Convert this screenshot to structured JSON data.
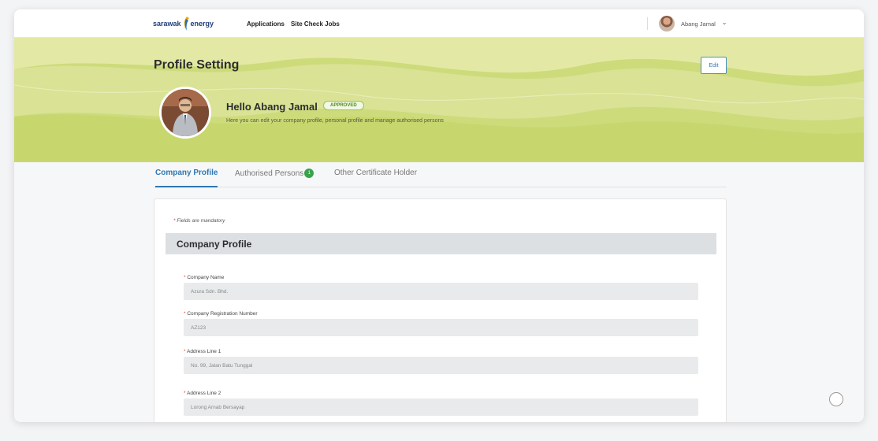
{
  "header": {
    "logo_left": "sarawak",
    "logo_right": "energy",
    "nav": [
      "Applications",
      "Site Check Jobs"
    ],
    "user_name": "Abang Jamal",
    "user_chevron": "⌄"
  },
  "banner": {
    "title": "Profile Setting",
    "edit_label": "Edit",
    "greeting": "Hello Abang Jamal",
    "status": "APPROVED",
    "subtitle": "Here you can edit your company profile, personal profile and manage authorised persons"
  },
  "tabs": [
    {
      "label": "Company Profile",
      "active": true
    },
    {
      "label": "Authorised Persons",
      "count": "1"
    },
    {
      "label": "Other Certificate Holder"
    }
  ],
  "form": {
    "mandatory_note": "Fields are mandatory",
    "section_title": "Company Profile",
    "fields": [
      {
        "label": "Company Name",
        "value": "Azura Sdn. Bhd."
      },
      {
        "label": "Company Registration Number",
        "value": "AZ123"
      },
      {
        "label": "Address Line 1",
        "value": "No. 99, Jalan Batu Tunggal"
      },
      {
        "label": "Address Line 2",
        "value": "Lorong Arnab Bersayap"
      }
    ]
  },
  "icons": {
    "logo": "sarawak-energy-flame-icon",
    "user_menu": "chevron-down-icon",
    "fab": "circle-button-icon"
  },
  "colors": {
    "accent": "#2f77b3",
    "banner": "#cddb7a",
    "approved": "#4f8a1a",
    "count_badge": "#3aa24a",
    "required": "#e53935"
  }
}
